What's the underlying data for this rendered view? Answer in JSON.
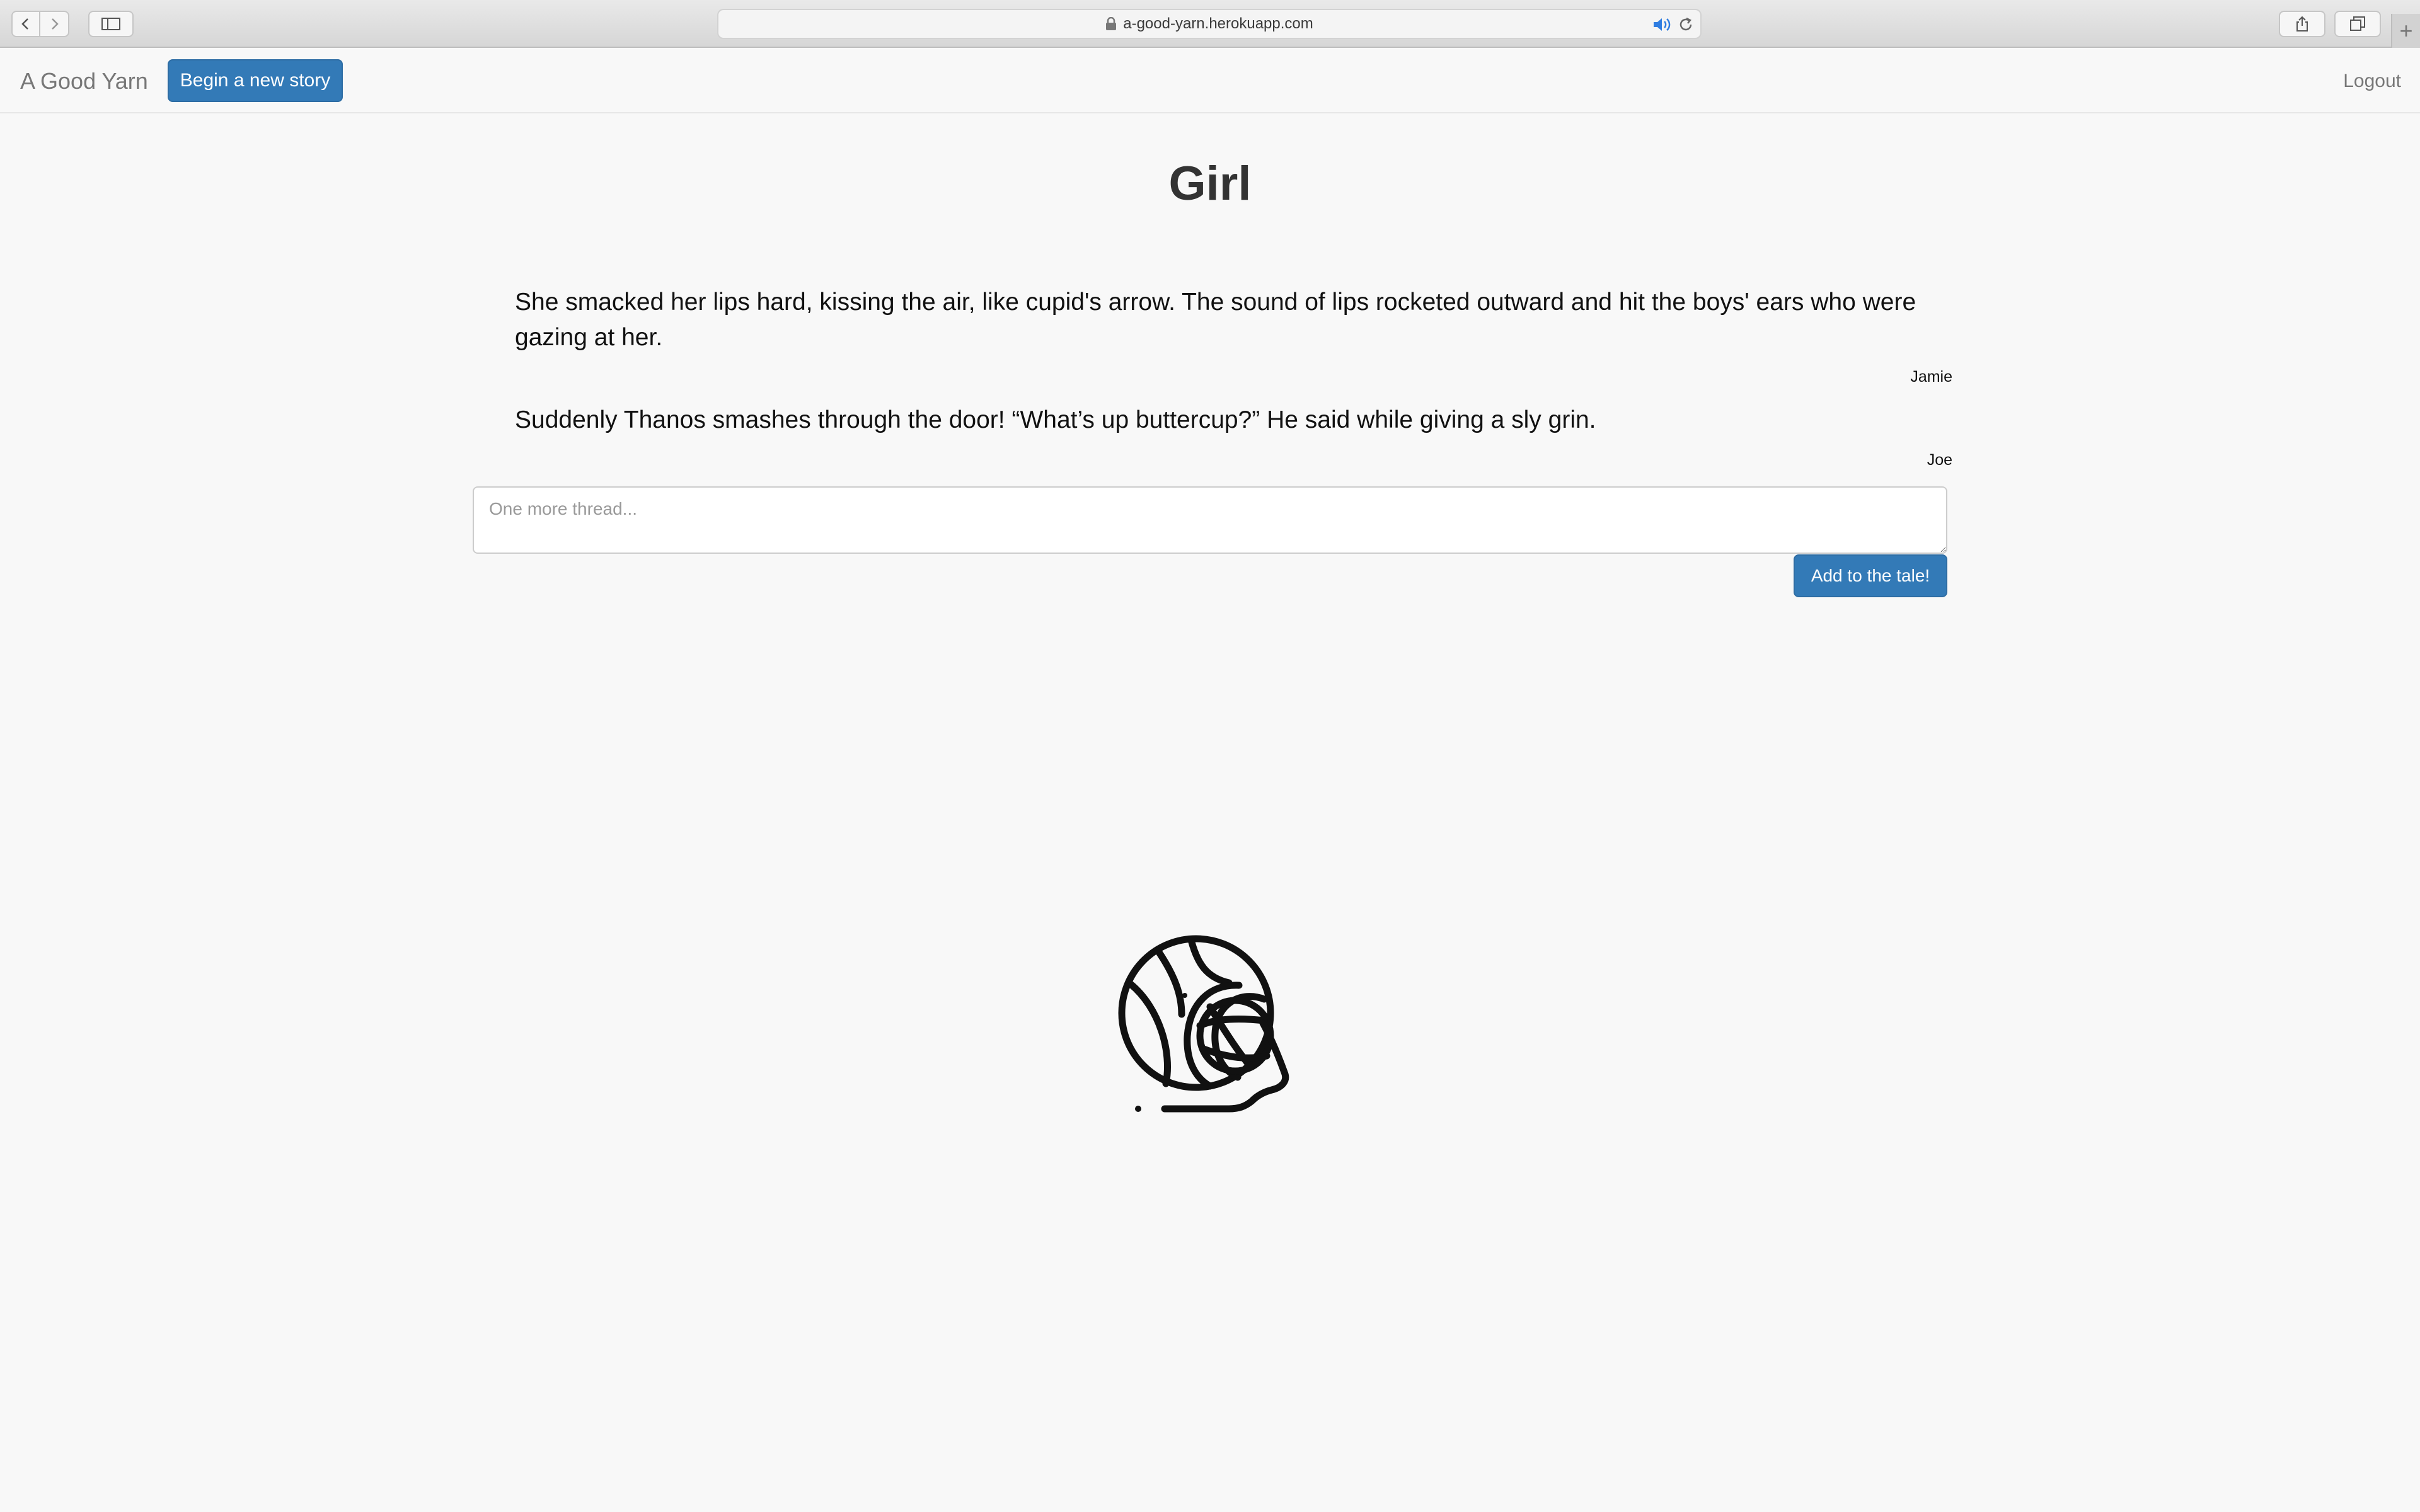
{
  "browser": {
    "url": "a-good-yarn.herokuapp.com",
    "new_tab_symbol": "+"
  },
  "navbar": {
    "brand": "A Good Yarn",
    "begin_button": "Begin a new story",
    "logout": "Logout"
  },
  "story": {
    "title": "Girl",
    "threads": [
      {
        "text": "She smacked her lips hard, kissing the air, like cupid's arrow. The sound of lips rocketed outward and hit the boys' ears who were gazing at her.",
        "author": "Jamie"
      },
      {
        "text": "Suddenly Thanos smashes through the door! “What’s up buttercup?” He said while giving a sly grin.",
        "author": "Joe"
      }
    ],
    "input_placeholder": "One more thread...",
    "input_value": "",
    "add_button": "Add to the tale!"
  },
  "colors": {
    "primary": "#337ab7",
    "background": "#f8f8f8",
    "nav_text": "#777777"
  },
  "icons": [
    "back-icon",
    "forward-icon",
    "sidebar-icon",
    "lock-icon",
    "sound-icon",
    "reload-icon",
    "share-icon",
    "tabs-icon",
    "yarn-ball-icon"
  ]
}
